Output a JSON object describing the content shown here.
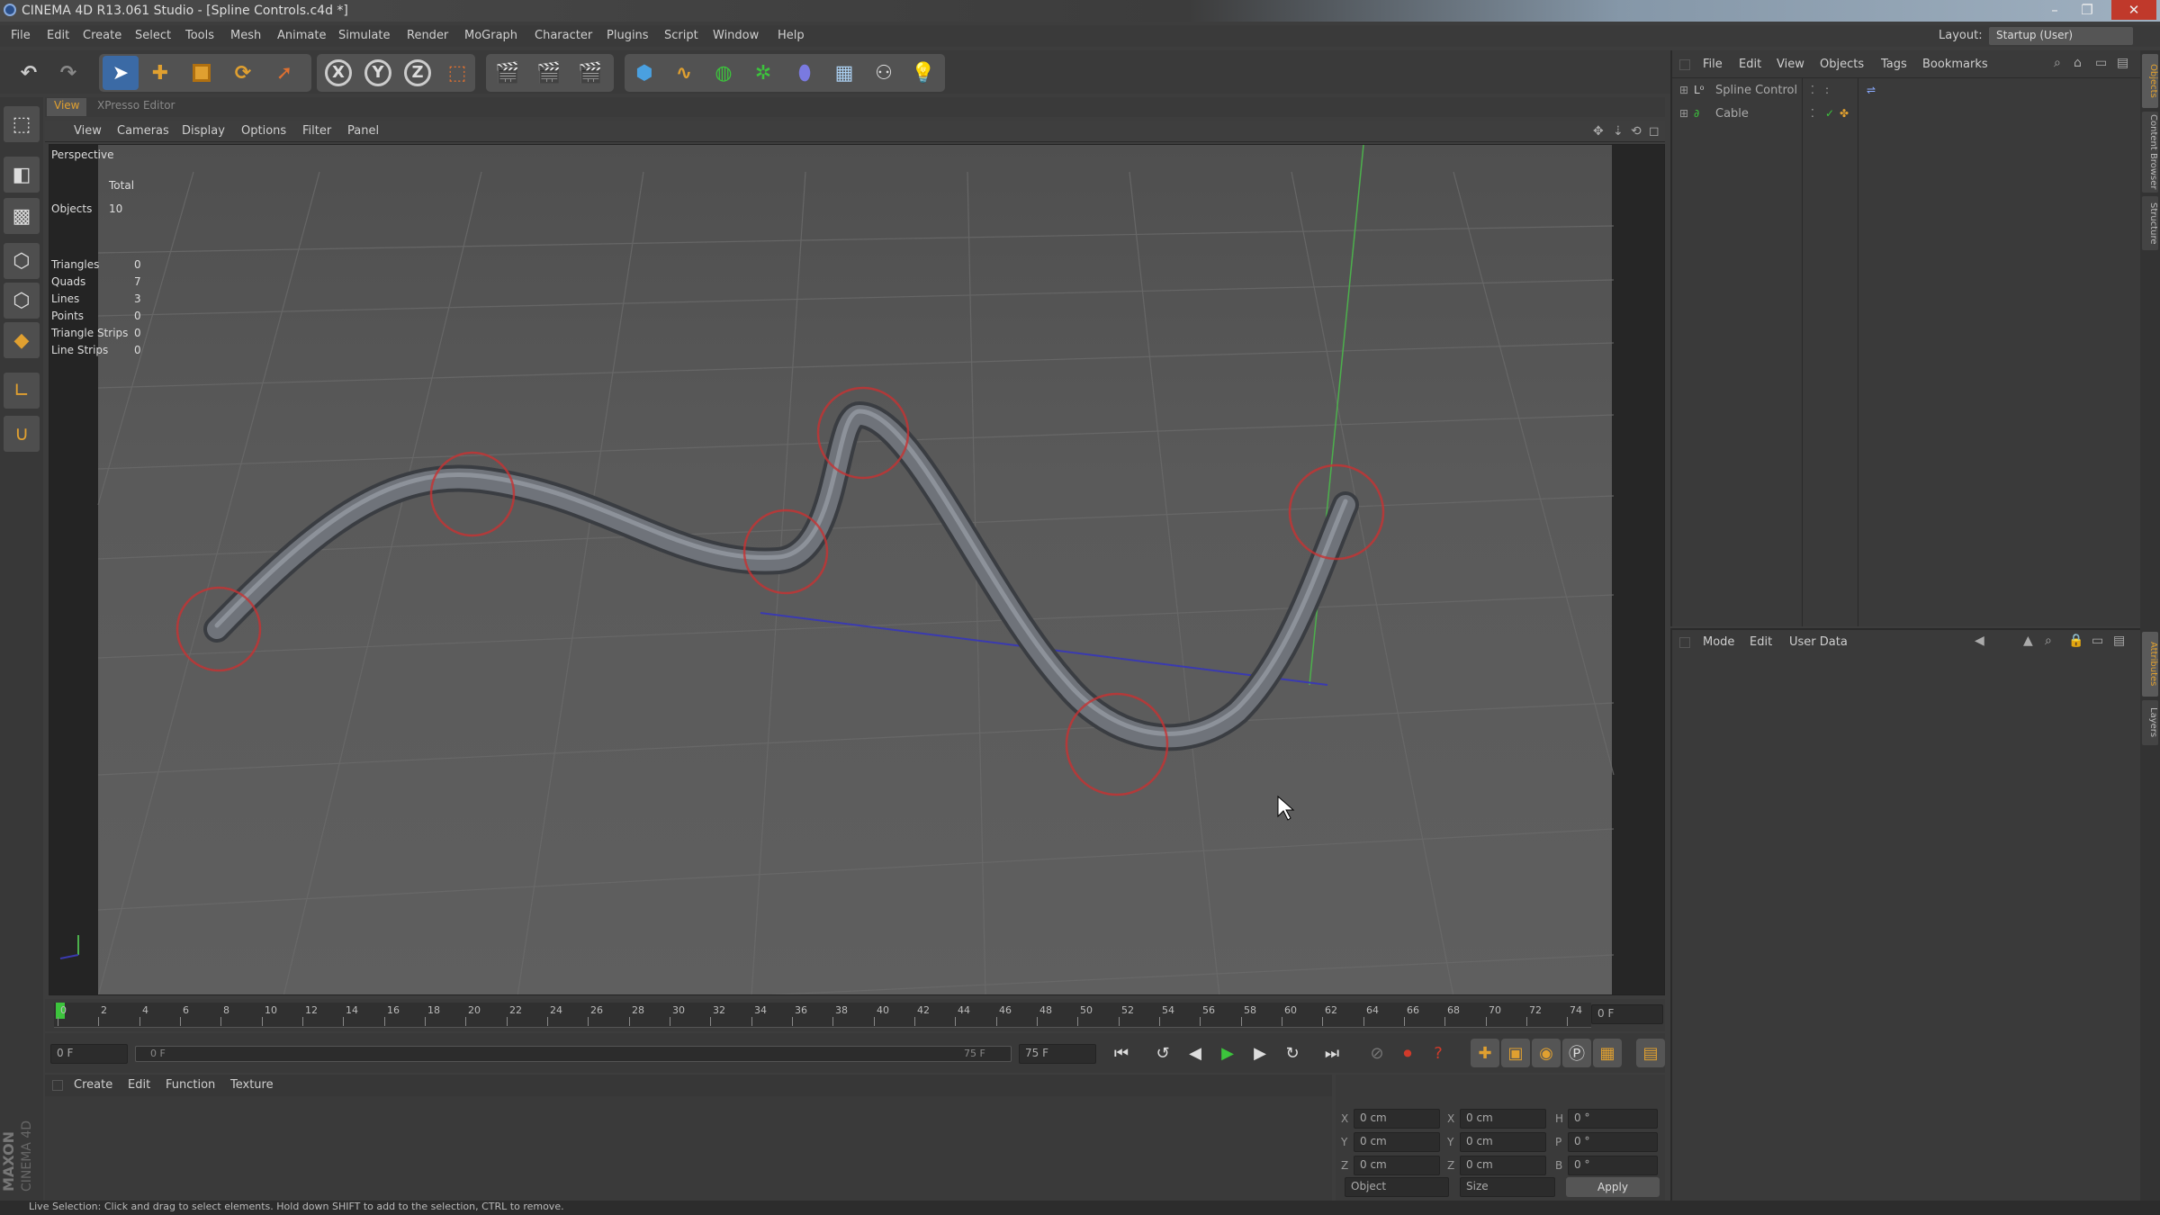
{
  "window": {
    "title": "CINEMA 4D R13.061 Studio - [Spline Controls.c4d *]",
    "controls": [
      "–",
      "❐",
      "✕"
    ]
  },
  "menubar": {
    "items": [
      "File",
      "Edit",
      "Create",
      "Select",
      "Tools",
      "Mesh",
      "Animate",
      "Simulate",
      "Render",
      "MoGraph",
      "Character",
      "Plugins",
      "Script",
      "Window",
      "Help"
    ],
    "layout_label": "Layout:",
    "layout_value": "Startup (User)"
  },
  "toolbar": {
    "undo": "↶",
    "redo": "↷",
    "axis_x": "X",
    "axis_y": "Y",
    "axis_z": "Z"
  },
  "viewport": {
    "tabs": [
      "View",
      "XPresso Editor"
    ],
    "menu": [
      "View",
      "Cameras",
      "Display",
      "Options",
      "Filter",
      "Panel"
    ],
    "camera_label": "Perspective",
    "stats": {
      "header": "Total",
      "objects_label": "Objects",
      "objects_value": "10",
      "rows": [
        {
          "label": "Triangles",
          "value": "0"
        },
        {
          "label": "Quads",
          "value": "7"
        },
        {
          "label": "Lines",
          "value": "3"
        },
        {
          "label": "Points",
          "value": "0"
        },
        {
          "label": "Triangle Strips",
          "value": "0"
        },
        {
          "label": "Line Strips",
          "value": "0"
        }
      ]
    }
  },
  "timeline": {
    "ticks": [
      "0",
      "2",
      "4",
      "6",
      "8",
      "10",
      "12",
      "14",
      "16",
      "18",
      "20",
      "22",
      "24",
      "26",
      "28",
      "30",
      "32",
      "34",
      "36",
      "38",
      "40",
      "42",
      "44",
      "46",
      "48",
      "50",
      "52",
      "54",
      "56",
      "58",
      "60",
      "62",
      "64",
      "66",
      "68",
      "70",
      "72",
      "74"
    ],
    "current_frame": "0 F",
    "start_field": "0 F",
    "range_start": "0 F",
    "range_end": "75 F",
    "end_field": "75 F"
  },
  "material_manager": {
    "menu": [
      "Create",
      "Edit",
      "Function",
      "Texture"
    ]
  },
  "coordinates": {
    "rows": [
      {
        "axis1": "X",
        "v1": "0 cm",
        "axis2": "X",
        "v2": "0 cm",
        "axis3": "H",
        "v3": "0 °"
      },
      {
        "axis1": "Y",
        "v1": "0 cm",
        "axis2": "Y",
        "v2": "0 cm",
        "axis3": "P",
        "v3": "0 °"
      },
      {
        "axis1": "Z",
        "v1": "0 cm",
        "axis2": "Z",
        "v2": "0 cm",
        "axis3": "B",
        "v3": "0 °"
      }
    ],
    "mode_select": "Object",
    "size_select": "Size",
    "apply_label": "Apply"
  },
  "object_manager": {
    "menu": [
      "File",
      "Edit",
      "View",
      "Objects",
      "Tags",
      "Bookmarks"
    ],
    "objects": [
      {
        "name": "Spline Control"
      },
      {
        "name": "Cable"
      }
    ]
  },
  "attribute_manager": {
    "menu": [
      "Mode",
      "Edit",
      "User Data"
    ]
  },
  "right_tabs": [
    "Objects",
    "Content Browser",
    "Structure",
    "Attributes",
    "Layers"
  ],
  "status": {
    "text": "Live Selection: Click and drag to select elements. Hold down SHIFT to add to the selection, CTRL to remove."
  },
  "brand": {
    "line1": "MAXON",
    "line2": "CINEMA 4D"
  },
  "colors": {
    "accent_orange": "#e0a030",
    "play_green": "#3cc43c",
    "record_red": "#d03a2a",
    "axis_green": "#4cb04c",
    "axis_blue": "#3a3ab0",
    "highlight_circle": "#c83232"
  }
}
